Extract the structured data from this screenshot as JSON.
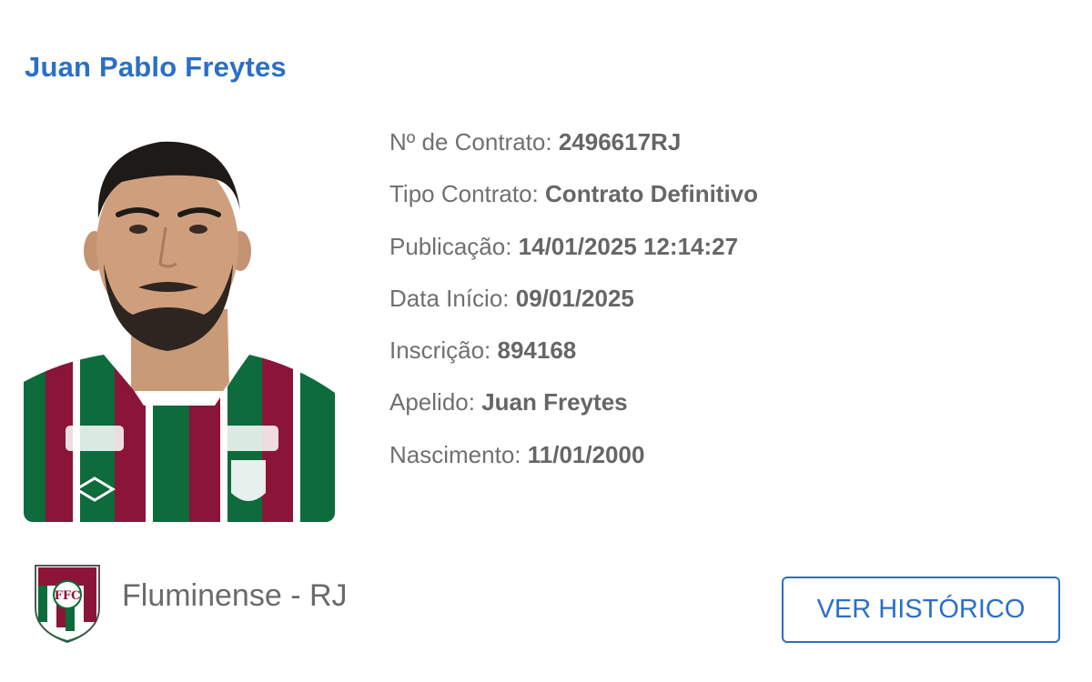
{
  "player": {
    "name": "Juan Pablo Freytes",
    "photo_icon": "player-photo"
  },
  "details": {
    "contract_number_label": "Nº de Contrato:",
    "contract_number_value": "2496617RJ",
    "contract_type_label": "Tipo Contrato:",
    "contract_type_value": "Contrato Definitivo",
    "publication_label": "Publicação:",
    "publication_value": "14/01/2025 12:14:27",
    "start_date_label": "Data Início:",
    "start_date_value": "09/01/2025",
    "registration_label": "Inscrição:",
    "registration_value": "894168",
    "nickname_label": "Apelido:",
    "nickname_value": "Juan Freytes",
    "birth_label": "Nascimento:",
    "birth_value": "11/01/2000"
  },
  "club": {
    "name": "Fluminense - RJ",
    "crest_icon": "fluminense-crest",
    "crest_text": "FFC"
  },
  "actions": {
    "history_button_label": "VER HISTÓRICO"
  },
  "colors": {
    "title_blue": "#2a6fc9",
    "label_gray": "#707070",
    "fluminense_green": "#0b6b3a",
    "fluminense_grena": "#8a1538"
  }
}
